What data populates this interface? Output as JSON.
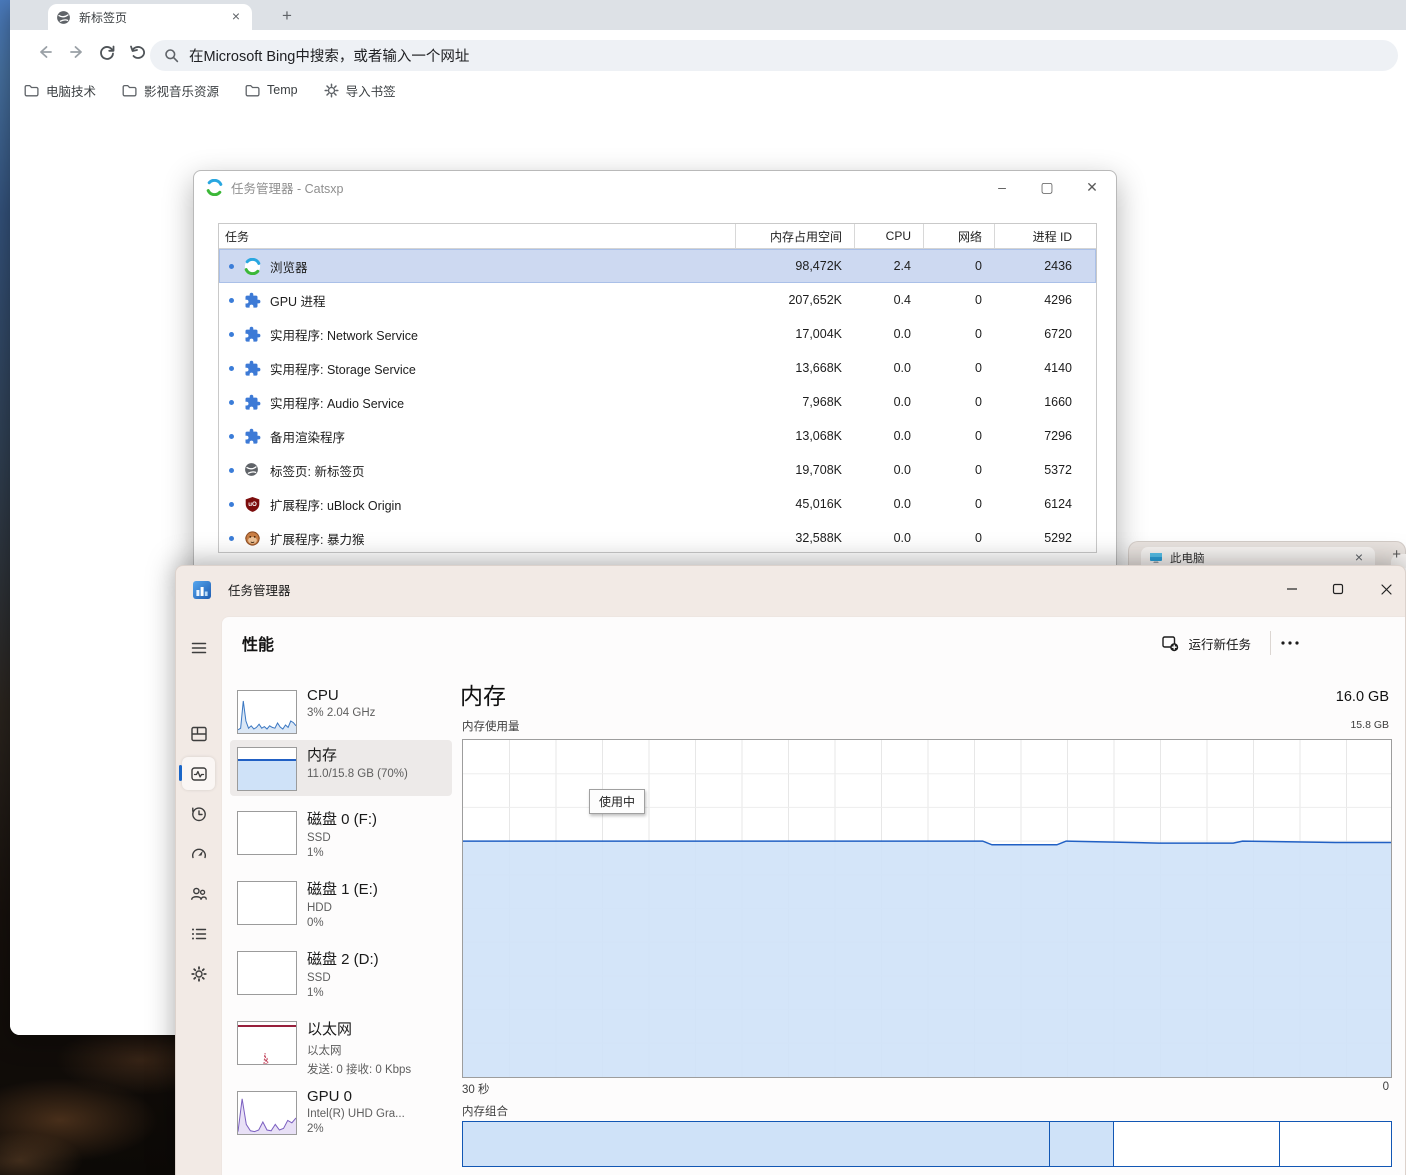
{
  "browser": {
    "tab_title": "新标签页",
    "omnibox_text": "在Microsoft Bing中搜索，或者输入一个网址",
    "bookmarks": [
      {
        "label": "电脑技术",
        "icon": "folder-icon"
      },
      {
        "label": "影视音乐资源",
        "icon": "folder-icon"
      },
      {
        "label": "Temp",
        "icon": "folder-icon"
      },
      {
        "label": "导入书签",
        "icon": "gear-icon"
      }
    ]
  },
  "browser_task_manager": {
    "title": "任务管理器 - Catsxp",
    "columns": {
      "task": "任务",
      "memory": "内存占用空间",
      "cpu": "CPU",
      "network": "网络",
      "pid": "进程 ID"
    },
    "rows": [
      {
        "task": "浏览器",
        "icon": "catsxp",
        "memory": "98,472K",
        "cpu": "2.4",
        "network": "0",
        "pid": "2436",
        "selected": true
      },
      {
        "task": "GPU 进程",
        "icon": "puzzle",
        "memory": "207,652K",
        "cpu": "0.4",
        "network": "0",
        "pid": "4296"
      },
      {
        "task": "实用程序: Network Service",
        "icon": "puzzle",
        "memory": "17,004K",
        "cpu": "0.0",
        "network": "0",
        "pid": "6720"
      },
      {
        "task": "实用程序: Storage Service",
        "icon": "puzzle",
        "memory": "13,668K",
        "cpu": "0.0",
        "network": "0",
        "pid": "4140"
      },
      {
        "task": "实用程序: Audio Service",
        "icon": "puzzle",
        "memory": "7,968K",
        "cpu": "0.0",
        "network": "0",
        "pid": "1660"
      },
      {
        "task": "备用渲染程序",
        "icon": "puzzle",
        "memory": "13,068K",
        "cpu": "0.0",
        "network": "0",
        "pid": "7296"
      },
      {
        "task": "标签页: 新标签页",
        "icon": "globe",
        "memory": "19,708K",
        "cpu": "0.0",
        "network": "0",
        "pid": "5372"
      },
      {
        "task": "扩展程序: uBlock Origin",
        "icon": "ublock",
        "memory": "45,016K",
        "cpu": "0.0",
        "network": "0",
        "pid": "6124"
      },
      {
        "task": "扩展程序: 暴力猴",
        "icon": "monkey",
        "memory": "32,588K",
        "cpu": "0.0",
        "network": "0",
        "pid": "5292"
      }
    ]
  },
  "explorer_peek": {
    "title": "此电脑"
  },
  "task_manager": {
    "title": "任务管理器",
    "page_title": "性能",
    "run_new_task_label": "运行新任务",
    "rail_icons": [
      "processes-icon",
      "performance-icon",
      "app-history-icon",
      "startup-apps-icon",
      "users-icon",
      "details-icon",
      "services-icon"
    ],
    "rail_selected_index": 1,
    "sidebar": [
      {
        "kind": "cpu",
        "name": "CPU",
        "lines": [
          "3%  2.04 GHz"
        ]
      },
      {
        "kind": "memory",
        "name": "内存",
        "lines": [
          "11.0/15.8 GB (70%)"
        ],
        "selected": true
      },
      {
        "kind": "disk",
        "name": "磁盘 0 (F:)",
        "lines": [
          "SSD",
          "1%"
        ]
      },
      {
        "kind": "disk",
        "name": "磁盘 1 (E:)",
        "lines": [
          "HDD",
          "0%"
        ]
      },
      {
        "kind": "disk",
        "name": "磁盘 2 (D:)",
        "lines": [
          "SSD",
          "1%"
        ]
      },
      {
        "kind": "ethernet",
        "name": "以太网",
        "lines": [
          "以太网",
          "发送: 0 接收: 0 Kbps"
        ]
      },
      {
        "kind": "gpu",
        "name": "GPU 0",
        "lines": [
          "Intel(R) UHD Gra...",
          "2%"
        ]
      }
    ],
    "memory_panel": {
      "title": "内存",
      "total": "16.0 GB",
      "usage_label": "内存使用量",
      "scale_max": "15.8 GB",
      "tooltip": "使用中",
      "time_label": "30 秒",
      "zero_label": "0",
      "composition_label": "内存组合"
    }
  },
  "chart_data": {
    "type": "area",
    "title": "内存使用量",
    "ylabel": "GB",
    "ylim": [
      0,
      15.8
    ],
    "x_range_label": "30 秒 → 0",
    "used_gb": 11.0,
    "total_gb": 15.8,
    "used_percent": 70,
    "usage_trend_percent": [
      [
        0,
        70
      ],
      [
        40,
        70
      ],
      [
        56,
        70
      ],
      [
        57,
        68.9
      ],
      [
        64,
        68.9
      ],
      [
        65,
        70
      ],
      [
        75,
        69.4
      ],
      [
        83,
        69.4
      ],
      [
        84,
        70
      ],
      [
        94,
        69.6
      ],
      [
        100,
        69.6
      ]
    ],
    "composition_segments": [
      {
        "name": "in-use",
        "percent": 63.1,
        "filled": true
      },
      {
        "name": "modified",
        "percent": 6.9,
        "filled": true
      },
      {
        "name": "standby",
        "percent": 17.9,
        "filled": false
      },
      {
        "name": "free",
        "percent": 12.1,
        "filled": false
      }
    ],
    "cpu_spark": [
      8,
      12,
      80,
      30,
      12,
      18,
      10,
      14,
      22,
      12,
      16,
      10,
      18,
      14,
      12,
      25,
      15,
      10,
      20,
      14,
      30,
      26,
      18
    ],
    "gpu_spark": [
      6,
      88,
      24,
      8,
      6,
      10,
      30,
      10,
      8,
      24,
      10,
      14,
      34,
      28,
      40
    ],
    "colors": {
      "accent": "#1a66c8",
      "memory_fill": "#cfe2f8",
      "memory_line": "#2160c4",
      "ethernet_line": "#98203c",
      "gpu_line": "#7b5fc0",
      "mica": "#f2eae5"
    }
  }
}
